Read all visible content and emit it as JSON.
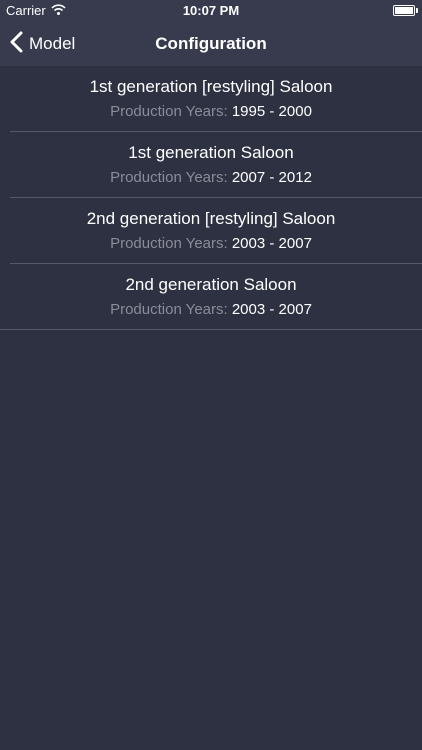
{
  "status_bar": {
    "carrier": "Carrier",
    "time": "10:07 PM",
    "icons": [
      "wifi-icon",
      "battery-icon"
    ]
  },
  "nav": {
    "back_label": "Model",
    "back_icon": "chevron-left-icon",
    "title": "Configuration"
  },
  "configurations": [
    {
      "title": "1st generation [restyling] Saloon",
      "years_label": "Production Years:",
      "years": "1995 - 2000"
    },
    {
      "title": "1st generation Saloon",
      "years_label": "Production Years:",
      "years": "2007 - 2012"
    },
    {
      "title": "2nd generation [restyling] Saloon",
      "years_label": "Production Years:",
      "years": "2003 - 2007"
    },
    {
      "title": "2nd generation Saloon",
      "years_label": "Production Years:",
      "years": "2003 - 2007"
    }
  ],
  "colors": {
    "background": "#2e3142",
    "bar": "#383b4d",
    "text": "#ffffff",
    "muted": "#8a8c99",
    "separator": "#555868"
  }
}
